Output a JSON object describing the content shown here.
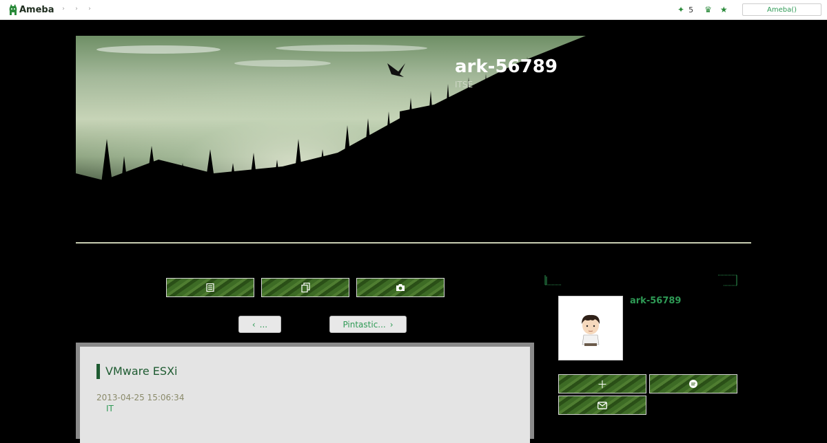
{
  "topbar": {
    "logo_text": "Ameba",
    "breadcrumb": [
      "›",
      "›",
      "›"
    ],
    "notification_count": "5",
    "account_button": "Ameba()"
  },
  "header": {
    "blog_title": "ark-56789",
    "blog_subtitle": "ITSE"
  },
  "nav_buttons": [
    {
      "icon": "article-icon"
    },
    {
      "icon": "copy-icon"
    },
    {
      "icon": "camera-icon"
    }
  ],
  "pager": {
    "prev_label": "...",
    "next_label": "Pintastic..."
  },
  "entry": {
    "title": "VMware ESXi",
    "date": "2013-04-25 15:06:34",
    "category": "IT"
  },
  "sidebar": {
    "profile_name": "ark-56789",
    "buttons": [
      {
        "icon": "plus-icon"
      },
      {
        "icon": "chat-icon"
      },
      {
        "icon": "mail-icon"
      }
    ]
  },
  "colors": {
    "accent_green": "#2e9a55",
    "title_green": "#1e5b31",
    "button_green": "#3d6b25"
  }
}
